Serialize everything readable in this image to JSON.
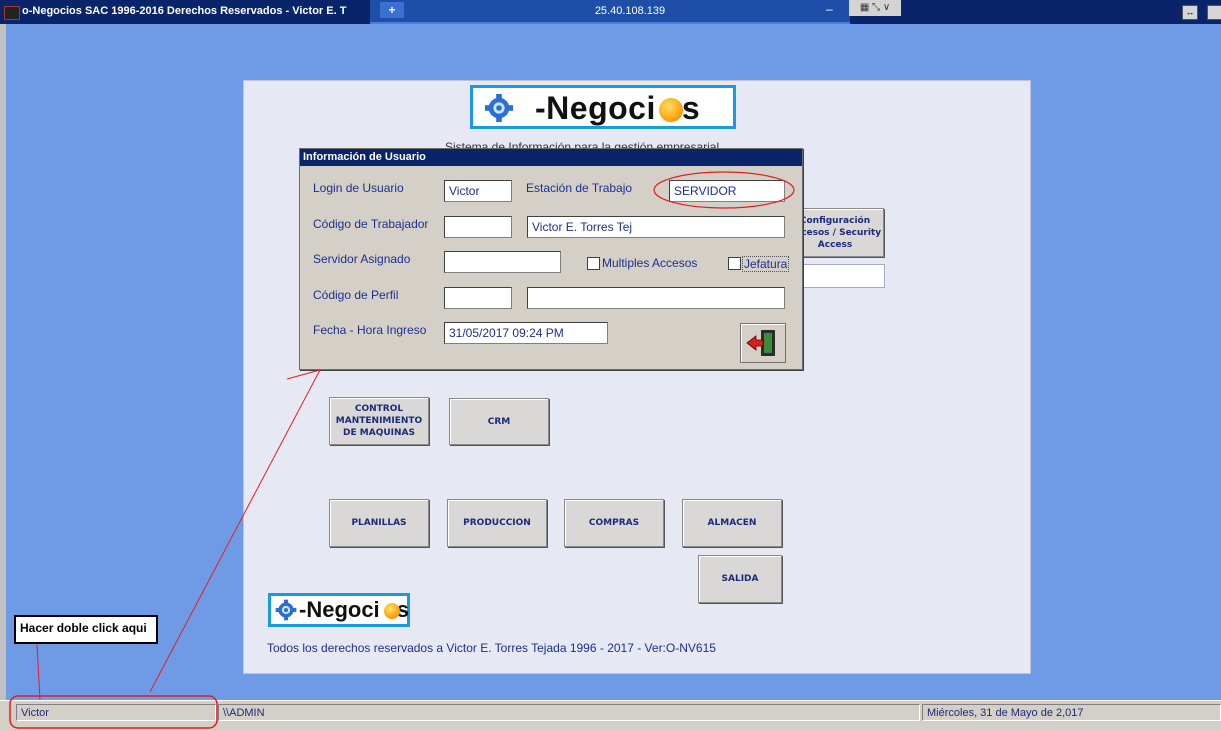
{
  "window": {
    "title": "o-Negocios SAC 1996-2016 Derechos Reservados - Victor E. T",
    "remote_ip": "25.40.108.139",
    "pin_label": "+",
    "minimize_label": "–",
    "restore_label": "▦ ⤡ ∨",
    "resize_label": "↔"
  },
  "logo": {
    "prefix": "-Negoci",
    "suffix": "s",
    "brand_color": "#1a9be0"
  },
  "main": {
    "partial_text": "Sistema de Información para la gestión empresarial",
    "security_button": "Configuración\nAccesos / Security\nAccess",
    "modules": {
      "control_mantenimiento": "CONTROL\nMANTENIMIENTO\nDE MAQUINAS",
      "crm": "CRM",
      "planillas": "PLANILLAS",
      "produccion": "PRODUCCION",
      "compras": "COMPRAS",
      "almacen": "ALMACEN",
      "salida": "SALIDA"
    },
    "footer": "Todos los derechos reservados a Victor E. Torres Tejada 1996 - 2017 -  Ver:O-NV615"
  },
  "dialog": {
    "title": "Información de Usuario",
    "login_label": "Login de Usuario",
    "login_value": "Victor",
    "station_label": "Estación de Trabajo",
    "station_value": "SERVIDOR",
    "worker_code_label": "Código de Trabajador",
    "worker_code_value": "",
    "worker_name_value": "Victor E. Torres Tej",
    "server_label": "Servidor Asignado",
    "server_value": "",
    "multiple_access_label": "Multiples Accesos",
    "multiple_access_checked": false,
    "jefatura_label": "Jefatura",
    "jefatura_checked": false,
    "profile_label": "Código de Perfil",
    "profile_code_value": "",
    "profile_name_value": "",
    "datetime_label": "Fecha - Hora Ingreso",
    "datetime_value": "31/05/2017 09:24 PM"
  },
  "statusbar": {
    "user": "Victor",
    "server": "\\\\ADMIN",
    "date": "Miércoles, 31 de Mayo de 2,017"
  },
  "annotation": {
    "text": "Hacer doble click aqui",
    "highlight_color": "#e02020"
  }
}
